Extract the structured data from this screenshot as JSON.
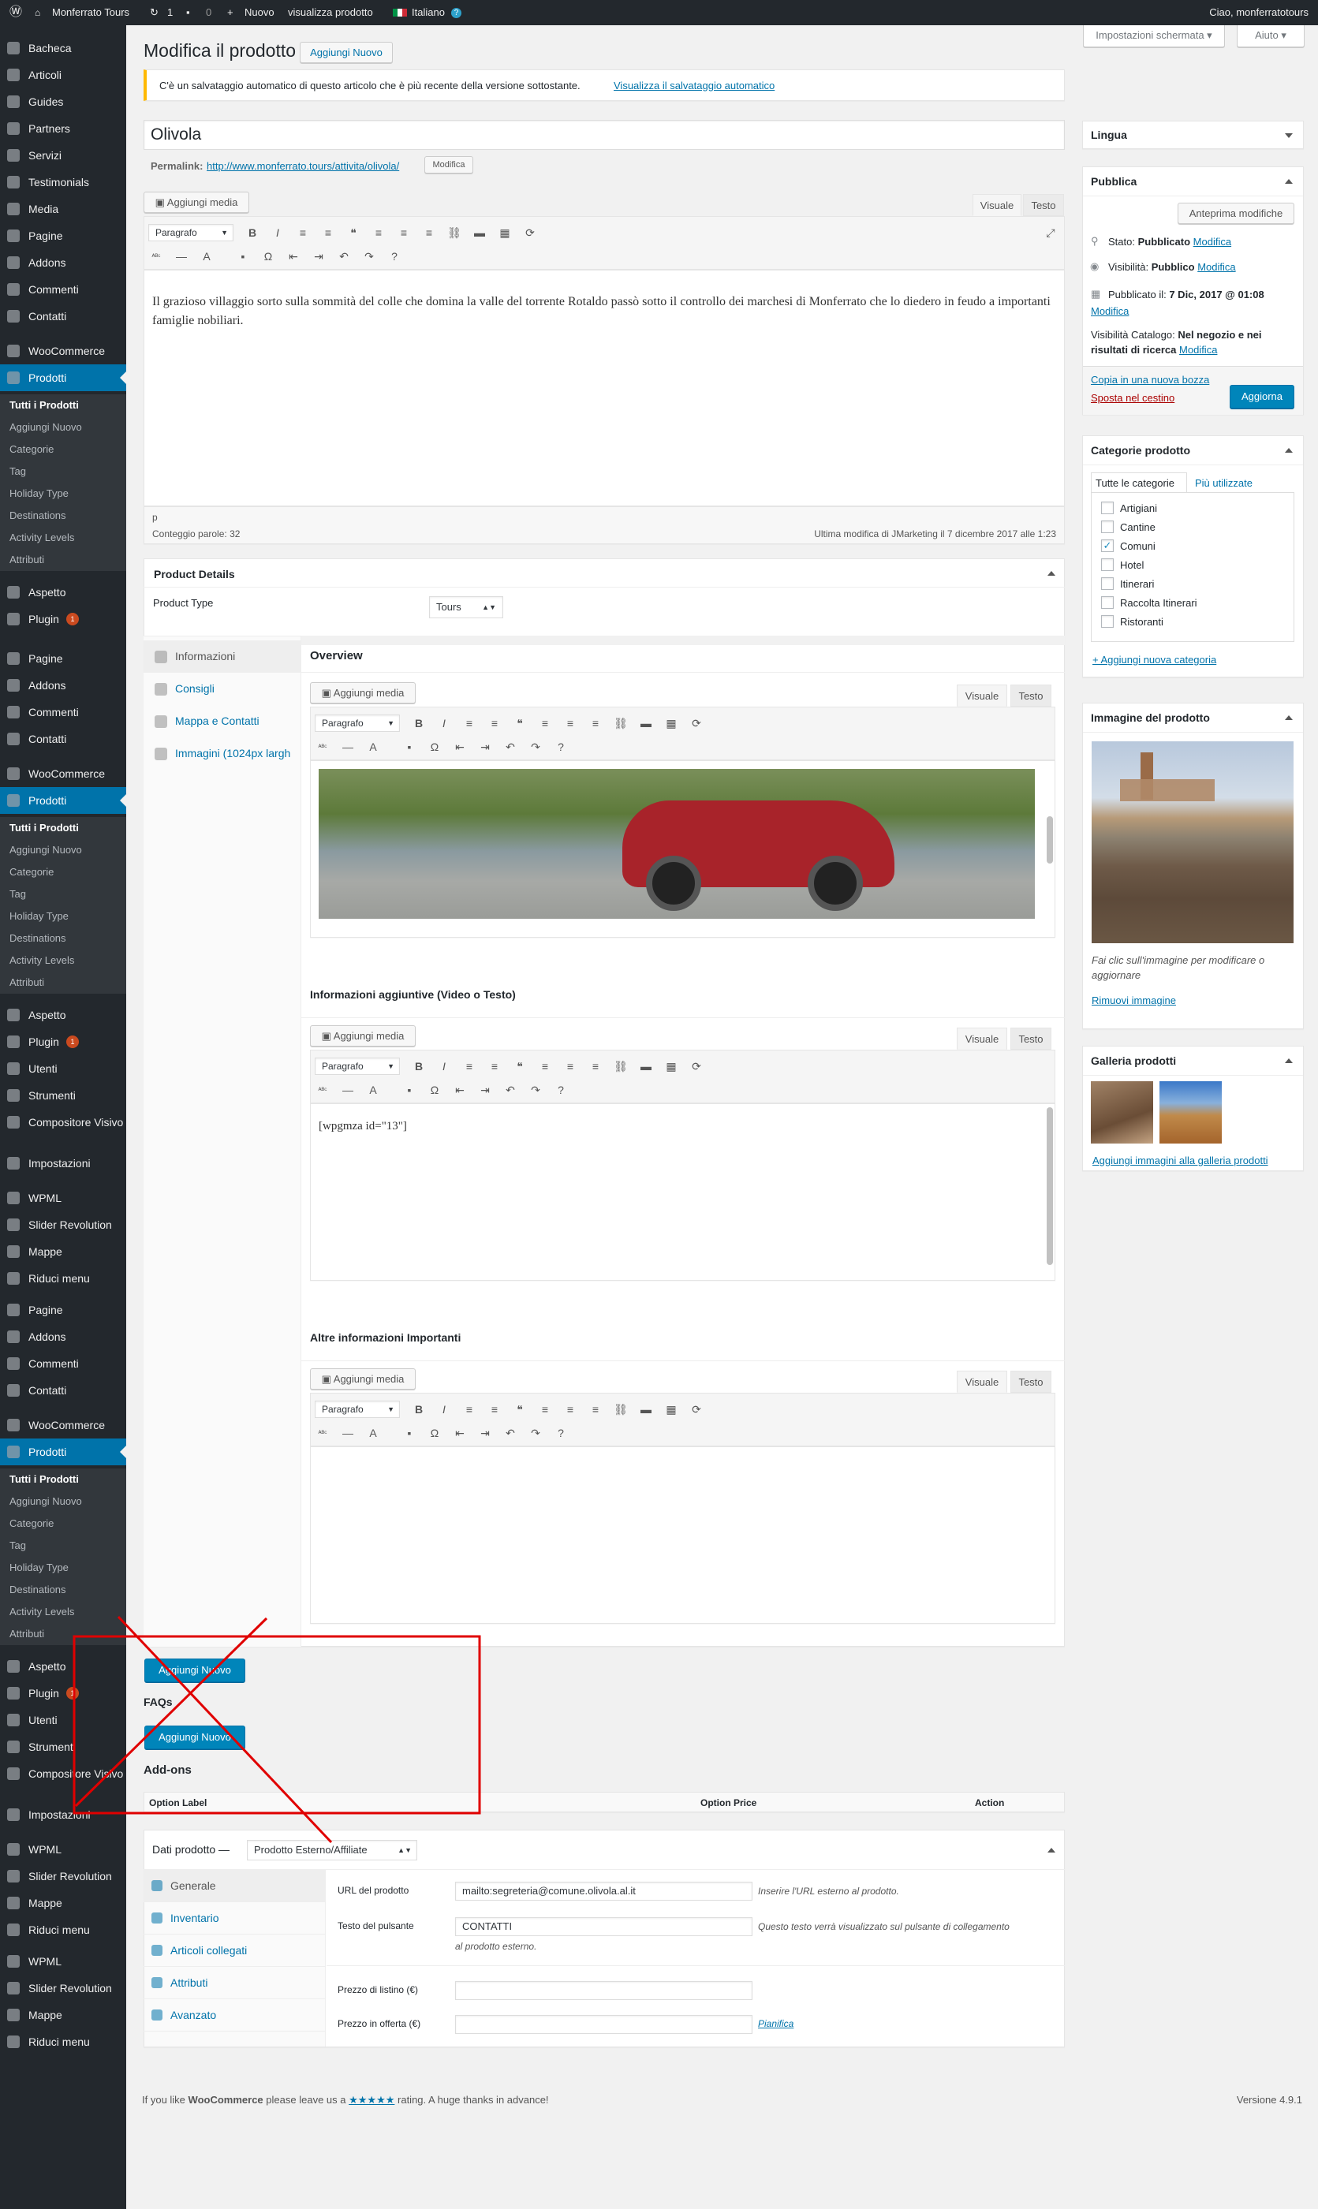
{
  "adminbar": {
    "site": "Monferrato Tours",
    "updates": "1",
    "comments": "0",
    "new": "Nuovo",
    "view": "visualizza prodotto",
    "lang": "Italiano",
    "greeting": "Ciao, monferratotours"
  },
  "menu": {
    "groups": [
      {
        "items": [
          "Bacheca",
          "Articoli",
          "Guides",
          "Partners",
          "Servizi",
          "Testimonials",
          "Media",
          "Pagine",
          "Addons",
          "Commenti",
          "Contatti"
        ],
        "woo": "WooCommerce",
        "products": "Prodotti",
        "sub": [
          "Tutti i Prodotti",
          "Aggiungi Nuovo",
          "Categorie",
          "Tag",
          "Holiday Type",
          "Destinations",
          "Activity Levels",
          "Attributi"
        ],
        "after": [
          "Aspetto",
          "Plugin"
        ]
      },
      {
        "items": [
          "Pagine",
          "Addons",
          "Commenti",
          "Contatti"
        ],
        "woo": "WooCommerce",
        "products": "Prodotti",
        "sub": [
          "Tutti i Prodotti",
          "Aggiungi Nuovo",
          "Categorie",
          "Tag",
          "Holiday Type",
          "Destinations",
          "Activity Levels",
          "Attributi"
        ],
        "after": [
          "Aspetto",
          "Plugin",
          "Utenti",
          "Strumenti",
          "Compositore Visivo",
          "Impostazioni"
        ],
        "extra": [
          "WPML",
          "Slider Revolution",
          "Mappe",
          "Riduci menu"
        ]
      }
    ],
    "plugin_badge": "1"
  },
  "header": {
    "title": "Modifica il prodotto",
    "add_new": "Aggiungi Nuovo",
    "screen_options": "Impostazioni schermata",
    "help": "Aiuto"
  },
  "notice": {
    "text": "C'è un salvataggio automatico di questo articolo che è più recente della versione sottostante.",
    "link": "Visualizza il salvataggio automatico"
  },
  "post": {
    "title": "Olivola",
    "permalink_label": "Permalink:",
    "permalink": "http://www.monferrato.tours/attivita/olivola/",
    "edit": "Modifica",
    "content": "Il grazioso villaggio sorto sulla sommità del colle che domina la valle del torrente Rotaldo passò sotto il controllo dei marchesi di Monferrato che lo diedero in feudo a importanti famiglie nobiliari.",
    "path": "p",
    "wordcount": "Conteggio parole: 32",
    "lastedit": "Ultima modifica di JMarketing il 7 dicembre 2017 alle 1:23"
  },
  "editor": {
    "add_media": "Aggiungi media",
    "tab_visual": "Visuale",
    "tab_text": "Testo",
    "format": "Paragrafo"
  },
  "product_details": {
    "title": "Product Details",
    "type_label": "Product Type",
    "type_value": "Tours",
    "tabs": [
      "Informazioni",
      "Consigli",
      "Mappa e Contatti",
      "Immagini (1024px largh"
    ],
    "overview": "Overview",
    "extra_info": "Informazioni aggiuntive (Video o Testo)",
    "shortcode": "[wpgmza id=\"13\"]",
    "important": "Altre informazioni Importanti"
  },
  "sections": {
    "add_new": "Aggiungi Nuovo",
    "faqs": "FAQs",
    "addons": "Add-ons",
    "col_label": "Option Label",
    "col_price": "Option Price",
    "col_action": "Action"
  },
  "product_data": {
    "title": "Dati prodotto —",
    "type": "Prodotto Esterno/Affiliate",
    "tabs": [
      "Generale",
      "Inventario",
      "Articoli collegati",
      "Attributi",
      "Avanzato"
    ],
    "url_label": "URL del prodotto",
    "url_value": "mailto:segreteria@comune.olivola.al.it",
    "url_hint": "Inserire l'URL esterno al prodotto.",
    "btn_label": "Testo del pulsante",
    "btn_value": "CONTATTI",
    "btn_hint": "Questo testo verrà visualizzato sul pulsante di collegamento",
    "btn_hint2": "al prodotto esterno.",
    "regular": "Prezzo di listino (€)",
    "sale": "Prezzo in offerta (€)",
    "schedule": "Pianifica"
  },
  "sidebar": {
    "lang": "Lingua",
    "publish": "Pubblica",
    "preview": "Anteprima modifiche",
    "status": "Stato:",
    "status_v": "Pubblicato",
    "modifica": "Modifica",
    "visibility": "Visibilità:",
    "visibility_v": "Pubblico",
    "published": "Pubblicato il:",
    "published_v": "7 Dic, 2017 @ 01:08",
    "catalog": "Visibilità Catalogo:",
    "catalog_v": "Nel negozio e nei",
    "catalog_v2": "risultati di ricerca",
    "copy": "Copia in una nuova bozza",
    "trash": "Sposta nel cestino",
    "update": "Aggiorna",
    "cats_title": "Categorie prodotto",
    "cats_all": "Tutte le categorie",
    "cats_used": "Più utilizzate",
    "cats": [
      "Artigiani",
      "Cantine",
      "Comuni",
      "Hotel",
      "Itinerari",
      "Raccolta Itinerari",
      "Ristoranti"
    ],
    "add_cat": "+ Aggiungi nuova categoria",
    "image_title": "Immagine del prodotto",
    "image_hint": "Fai clic sull'immagine per modificare o",
    "image_hint2": "aggiornare",
    "image_remove": "Rimuovi immagine",
    "gallery_title": "Galleria prodotti",
    "gallery_add": "Aggiungi immagini alla galleria prodotti"
  },
  "footer": {
    "pre": "If you like",
    "woo": "WooCommerce",
    "mid": "please leave us a",
    "stars": "★★★★★",
    "post": "rating. A huge thanks in advance!",
    "version": "Versione 4.9.1"
  },
  "colors": {
    "accent": "#0073aa",
    "menu_bg": "#23282d",
    "annotation": "#e00000"
  }
}
